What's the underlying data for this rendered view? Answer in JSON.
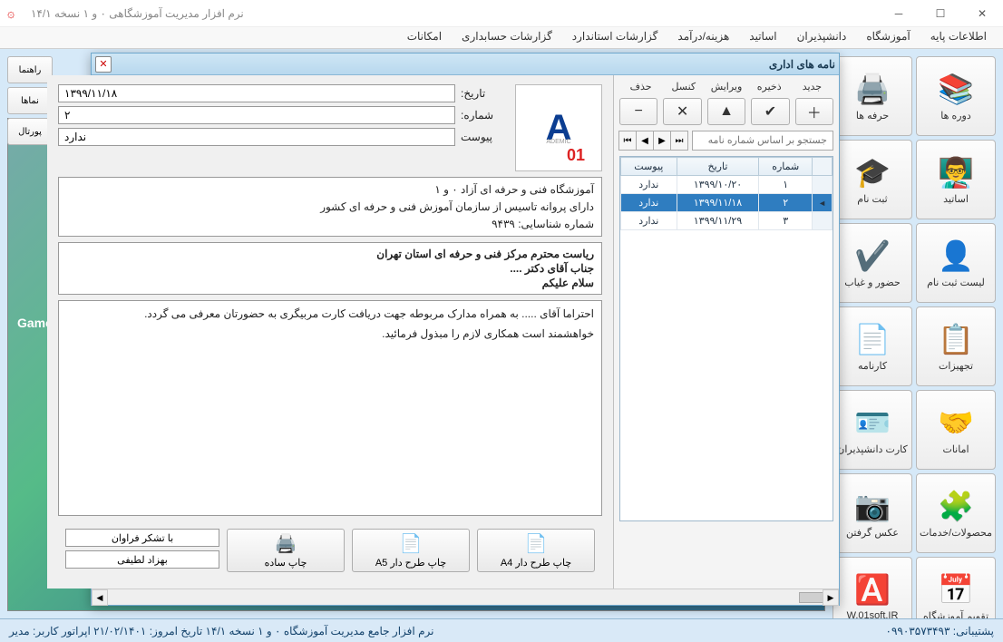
{
  "window": {
    "title": "نرم افزار مدیریت آموزشگاهی ۰ و ۱ نسخه ۱۴/۱"
  },
  "menu": [
    "اطلاعات پایه",
    "آموزشگاه",
    "دانشپذیران",
    "اساتید",
    "هزینه/درآمد",
    "گزارشات استاندارد",
    "گزارشات حسابداری",
    "امکانات"
  ],
  "leftToolbar": [
    "راهنما",
    "نماها",
    "پورتال"
  ],
  "sidebar": [
    {
      "label": "دوره ها",
      "icon": "📚"
    },
    {
      "label": "حرفه ها",
      "icon": "🖨️"
    },
    {
      "label": "اساتید",
      "icon": "👨‍🏫"
    },
    {
      "label": "ثبت نام",
      "icon": "🎓"
    },
    {
      "label": "لیست ثبت نام",
      "icon": "👤"
    },
    {
      "label": "حضور و غیاب",
      "icon": "✔️"
    },
    {
      "label": "تجهیزات",
      "icon": "📋"
    },
    {
      "label": "کارنامه",
      "icon": "📄"
    },
    {
      "label": "امانات",
      "icon": "🤝"
    },
    {
      "label": "کارت دانشپذیران",
      "icon": "🪪"
    },
    {
      "label": "محصولات/خدمات",
      "icon": "🧩"
    },
    {
      "label": "عکس گرفتن",
      "icon": "📷"
    },
    {
      "label": "تقویم آموزشگاه",
      "icon": "📅"
    },
    {
      "label": "W.01soft.IR",
      "icon": "🅰️"
    }
  ],
  "modal": {
    "title": "نامه های اداری",
    "toolbar": {
      "labels": [
        "جدید",
        "ذخیره",
        "ویرایش",
        "کنسل",
        "حذف"
      ],
      "icons": [
        "＋",
        "✔",
        "▲",
        "✕",
        "−"
      ]
    },
    "search_placeholder": "جستجو بر اساس شماره نامه",
    "grid": {
      "headers": [
        "شماره",
        "تاریخ",
        "پیوست"
      ],
      "rows": [
        {
          "no": "۱",
          "date": "۱۳۹۹/۱۰/۲۰",
          "att": "ندارد",
          "sel": false
        },
        {
          "no": "۲",
          "date": "۱۳۹۹/۱۱/۱۸",
          "att": "ندارد",
          "sel": true
        },
        {
          "no": "۳",
          "date": "۱۳۹۹/۱۱/۲۹",
          "att": "ندارد",
          "sel": false
        }
      ]
    },
    "form": {
      "date_label": "تاریخ:",
      "date": "۱۳۹۹/۱۱/۱۸",
      "no_label": "شماره:",
      "no": "۲",
      "att_label": "پیوست",
      "att": "ندارد",
      "org1": "آموزشگاه فنی و حرفه ای آزاد ۰ و ۱",
      "org2": "دارای پروانه تاسیس از سازمان آموزش فنی و حرفه ای کشور",
      "org3": "شماره شناسایی: ۹۴۳۹",
      "subj1": "ریاست محترم مرکز فنی و حرفه ای استان تهران",
      "subj2": "جناب آقای دکتر ....",
      "subj3": "سلام علیکم",
      "body": "احتراما آقای ..... به همراه مدارک مربوطه جهت دریافت کارت مربیگری به حضورتان معرفی می گردد.\nخواهشمند است همکاری لازم را مبذول فرمائید.",
      "sig1": "با تشکر فراوان",
      "sig2": "بهزاد لطیفی"
    },
    "print": {
      "a4": "چاپ طرح دار A4",
      "a5": "چاپ طرح دار A5",
      "simple": "چاپ ساده"
    }
  },
  "status": {
    "left": "نرم افزار جامع مدیریت آموزشگاه ۰ و ۱ نسخه ۱۴/۱   تاریخ امروز: ۲۱/۰۲/۱۴۰۱   اپراتور کاربر:  مدیر",
    "right": "پشتیبانی:  ۰۹۹۰۳۵۷۳۴۹۳"
  }
}
